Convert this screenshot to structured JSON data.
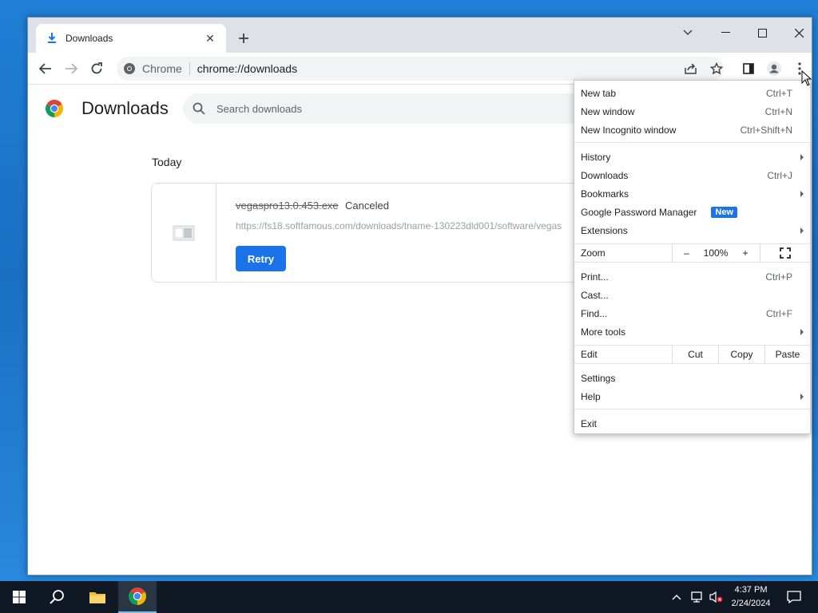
{
  "tab": {
    "title": "Downloads"
  },
  "omnibox": {
    "chip": "Chrome",
    "url": "chrome://downloads"
  },
  "page": {
    "title": "Downloads",
    "search_placeholder": "Search downloads",
    "section": "Today",
    "download": {
      "file_name": "vegaspro13.0.453.exe",
      "status": "Canceled",
      "url": "https://fs18.softfamous.com/downloads/tname-130223dld001/software/vegas",
      "retry_label": "Retry"
    }
  },
  "menu": {
    "new_tab": {
      "label": "New tab",
      "shortcut": "Ctrl+T"
    },
    "new_window": {
      "label": "New window",
      "shortcut": "Ctrl+N"
    },
    "new_incognito": {
      "label": "New Incognito window",
      "shortcut": "Ctrl+Shift+N"
    },
    "history": {
      "label": "History"
    },
    "downloads": {
      "label": "Downloads",
      "shortcut": "Ctrl+J"
    },
    "bookmarks": {
      "label": "Bookmarks"
    },
    "password_manager": {
      "label": "Google Password Manager",
      "badge": "New"
    },
    "extensions": {
      "label": "Extensions"
    },
    "zoom": {
      "label": "Zoom",
      "minus": "–",
      "value": "100%",
      "plus": "+"
    },
    "print": {
      "label": "Print...",
      "shortcut": "Ctrl+P"
    },
    "cast": {
      "label": "Cast..."
    },
    "find": {
      "label": "Find...",
      "shortcut": "Ctrl+F"
    },
    "more_tools": {
      "label": "More tools"
    },
    "edit": {
      "label": "Edit",
      "cut": "Cut",
      "copy": "Copy",
      "paste": "Paste"
    },
    "settings": {
      "label": "Settings"
    },
    "help": {
      "label": "Help"
    },
    "exit": {
      "label": "Exit"
    }
  },
  "taskbar": {
    "time": "4:37 PM",
    "date": "2/24/2024"
  },
  "colors": {
    "accent": "#1a73e8",
    "taskbar": "#101823",
    "desktop": "#1f7fd6"
  }
}
